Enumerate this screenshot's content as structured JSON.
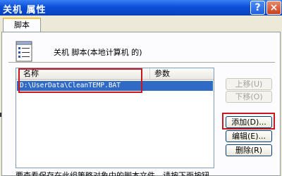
{
  "window": {
    "title": "关机 属性",
    "help_label": "?",
    "close_label": "×"
  },
  "tabs": [
    {
      "label": "脚本",
      "active": true
    }
  ],
  "header": {
    "text": "关机 脚本(本地计算机 的)",
    "icon": "script-list-icon"
  },
  "list": {
    "columns": [
      "名称",
      "参数"
    ],
    "rows": [
      {
        "name": "D:\\UserData\\CleanTEMP.BAT",
        "params": "",
        "selected": true
      }
    ]
  },
  "buttons": {
    "move_up": {
      "label": "上移(U)",
      "enabled": false
    },
    "move_down": {
      "label": "下移(O)",
      "enabled": false
    },
    "add": {
      "label": "添加(D)...",
      "enabled": true
    },
    "edit": {
      "label": "编辑(E)...",
      "enabled": true
    },
    "remove": {
      "label": "删除(R)",
      "enabled": true
    }
  },
  "footer": {
    "text": "要查看保存在此组策略对象中的脚本文件，请按下面按钮"
  },
  "colors": {
    "titlebar": "#0a4fd8",
    "selection": "#316ac5",
    "highlight_box": "#c8181e",
    "tab_accent": "#ffc83c"
  }
}
